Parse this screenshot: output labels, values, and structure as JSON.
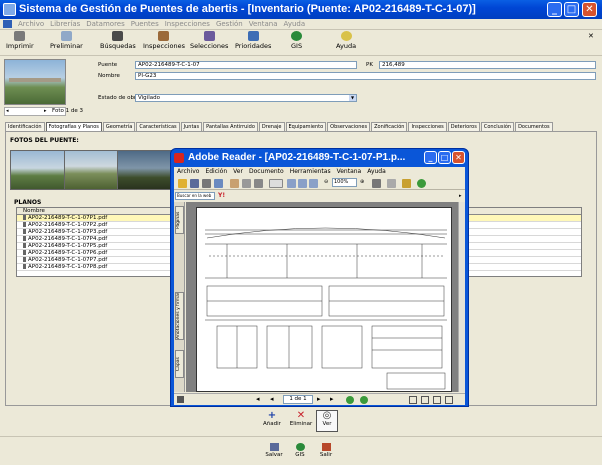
{
  "window": {
    "title": "Sistema de Gestión de Puentes de abertis - [Inventario (Puente: AP02-216489-T-C-1-07)]",
    "minimize": "_",
    "maximize": "□",
    "close": "✕"
  },
  "menu": [
    "Archivo",
    "Librerías",
    "Datamores",
    "Puentes",
    "Inspecciones",
    "Gestión",
    "Ventana",
    "Ayuda"
  ],
  "toolbar": [
    {
      "label": "Imprimir",
      "icon": "printer-icon"
    },
    {
      "label": "Preliminar",
      "icon": "print-preview-icon"
    },
    {
      "label": "Búsquedas",
      "icon": "search-binoculars-icon"
    },
    {
      "label": "Inspecciones",
      "icon": "inspections-icon"
    },
    {
      "label": "Selecciones",
      "icon": "selections-icon"
    },
    {
      "label": "Prioridades",
      "icon": "priorities-icon"
    },
    {
      "label": "GIS",
      "icon": "globe-icon"
    },
    {
      "label": "Ayuda",
      "icon": "help-icon"
    }
  ],
  "record": {
    "photo_counter": "Foto 1 de 3",
    "puente_label": "Puente",
    "puente_value": "AP02-216489-T-C-1-07",
    "pk_label": "PK",
    "pk_value": "216,489",
    "nombre_label": "Nombre",
    "nombre_value": "PI-G23",
    "estado_label": "Estado de obra",
    "estado_value": "Vigilado"
  },
  "tabs": [
    "Identificación",
    "Fotografías y Planos",
    "Geometría",
    "Características",
    "Juntas",
    "Pantallas Antirruido",
    "Drenaje",
    "Equipamiento",
    "Observaciones",
    "Zonificación",
    "Inspecciones",
    "Deterioros",
    "Conclusión",
    "Documentos"
  ],
  "fotos_title": "FOTOS DEL PUENTE:",
  "planos": {
    "title": "PLANOS",
    "header": "Nombre",
    "rows": [
      "AP02-216489-T-C-1-07P1.pdf",
      "AP02-216489-T-C-1-07P2.pdf",
      "AP02-216489-T-C-1-07P3.pdf",
      "AP02-216489-T-C-1-07P4.pdf",
      "AP02-216489-T-C-1-07P5.pdf",
      "AP02-216489-T-C-1-07P6.pdf",
      "AP02-216489-T-C-1-07P7.pdf",
      "AP02-216489-T-C-1-07P8.pdf"
    ]
  },
  "plan_buttons": {
    "add": "Añadir",
    "delete": "Eliminar",
    "view": "Ver"
  },
  "bottom_buttons": {
    "save": "Salvar",
    "gis": "GIS",
    "exit": "Salir"
  },
  "adobe": {
    "title": "Adobe Reader - [AP02-216489-T-C-1-07-P1.p...",
    "menu": [
      "Archivo",
      "Edición",
      "Ver",
      "Documento",
      "Herramientas",
      "Ventana",
      "Ayuda"
    ],
    "zoom": "100%",
    "search_placeholder": "Buscar en la web",
    "nav_tabs": [
      "Páginas",
      "Anotaciones y firmas",
      "Capas"
    ],
    "page_field": "1 de 1",
    "minimize": "_",
    "maximize": "□",
    "close": "✕"
  },
  "colors": {
    "titlebar": "#0046d5",
    "selected_row": "#fff8b8",
    "adobe_red": "#d8261f"
  }
}
